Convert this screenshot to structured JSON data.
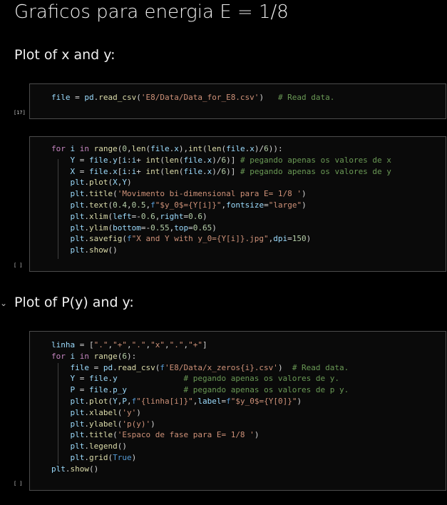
{
  "page_title": "Graficos para energia E = 1/8",
  "sections": [
    {
      "heading": "Plot of x and y:"
    },
    {
      "heading": "Plot of P(y) and y:",
      "collapse_icon": "chevron-down-icon"
    }
  ],
  "cells": [
    {
      "prompt": "[17]",
      "lines": [
        "file = pd.read_csv('E8/Data/Data_for_E8.csv')   # Read data."
      ]
    },
    {
      "prompt": "[ ]",
      "lines": [
        "for i in range(0,len(file.x),int(len(file.x)/6)):",
        "    Y = file.y[i:i+ int(len(file.x)/6)] # pegando apenas os valores de x",
        "    X = file.x[i:i+ int(len(file.x)/6)] # pegando apenas os valores de y",
        "    plt.plot(X,Y)",
        "    plt.title('Movimento bi-dimensional para E= 1/8 ')",
        "    plt.text(0.4,0.5,f\"$y_0$={Y[i]}\",fontsize=\"large\")",
        "    plt.xlim(left=-0.6,right=0.6)",
        "    plt.ylim(bottom=-0.55,top=0.65)",
        "    plt.savefig(f\"X and Y with y_0={Y[i]}.jpg\",dpi=150)",
        "    plt.show()"
      ]
    },
    {
      "prompt": "[ ]",
      "lines": [
        "linha = [\".\",\"+\",\".\",\"x\",\".\",\"+\"]",
        "for i in range(6):",
        "    file = pd.read_csv(f'E8/Data/x_zeros{i}.csv')  # Read data.",
        "    Y = file.y              # pegando apenas os valores de y.",
        "    P = file.p_y            # pegando apenas os valores de p y.",
        "    plt.plot(Y,P,f\"{linha[i]}\",label=f\"$y_0$={Y[0]}\")",
        "    plt.xlabel('y')",
        "    plt.ylabel('p(y)')",
        "    plt.title('Espaco de fase para E= 1/8 ')",
        "    plt.legend()",
        "    plt.grid(True)",
        "plt.show()"
      ]
    }
  ],
  "colors": {
    "background": "#000000",
    "cell_border": "#4c4c4c",
    "keyword": "#c586c0",
    "builtin": "#569cd6",
    "function": "#dcdcaa",
    "string": "#ce9178",
    "number": "#b5cea8",
    "comment": "#6a9955",
    "variable": "#9cdcfe"
  }
}
